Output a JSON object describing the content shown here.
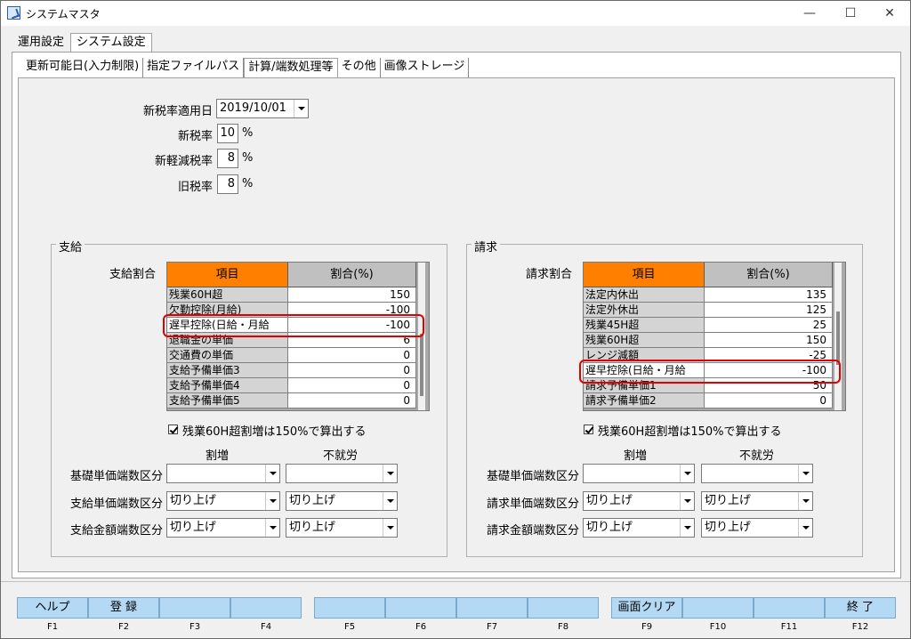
{
  "window": {
    "title": "システムマスタ",
    "minimize": "—",
    "maximize": "☐",
    "close": "✕"
  },
  "outer_tabs": [
    {
      "label": "運用設定"
    },
    {
      "label": "システム設定"
    }
  ],
  "inner_tabs": [
    {
      "label": "更新可能日(入力制限)"
    },
    {
      "label": "指定ファイルパス"
    },
    {
      "label": "計算/端数処理等"
    },
    {
      "label": "その他"
    },
    {
      "label": "画像ストレージ"
    }
  ],
  "tax": {
    "new_rate_date_label": "新税率適用日",
    "new_rate_date_value": "2019/10/01",
    "new_rate_label": "新税率",
    "new_rate_value": "10",
    "new_reduced_label": "新軽減税率",
    "new_reduced_value": "8",
    "old_rate_label": "旧税率",
    "old_rate_value": "8",
    "percent": "%"
  },
  "shikyu": {
    "group_title": "支給",
    "ratio_label": "支給割合",
    "headers": {
      "item": "項目",
      "rate": "割合(%)"
    },
    "rows": [
      {
        "name": "残業60H超",
        "value": "150"
      },
      {
        "name": "欠勤控除(月給)",
        "value": "-100"
      },
      {
        "name": "遅早控除(日給・月給",
        "value": "-100"
      },
      {
        "name": "退職金の単価",
        "value": "6"
      },
      {
        "name": "交通費の単価",
        "value": "0"
      },
      {
        "name": "支給予備単価3",
        "value": "0"
      },
      {
        "name": "支給予備単価4",
        "value": "0"
      },
      {
        "name": "支給予備単価5",
        "value": "0"
      }
    ],
    "checkbox_label": "残業60H超割増は150%で算出する",
    "col_warimashi": "割増",
    "col_fushuro": "不就労",
    "rounding": [
      {
        "label": "基礎単価端数区分",
        "warimashi": "",
        "fushuro": ""
      },
      {
        "label": "支給単価端数区分",
        "warimashi": "切り上げ",
        "fushuro": "切り上げ"
      },
      {
        "label": "支給金額端数区分",
        "warimashi": "切り上げ",
        "fushuro": "切り上げ"
      }
    ]
  },
  "seikyu": {
    "group_title": "請求",
    "ratio_label": "請求割合",
    "headers": {
      "item": "項目",
      "rate": "割合(%)"
    },
    "rows": [
      {
        "name": "法定内休出",
        "value": "135"
      },
      {
        "name": "法定外休出",
        "value": "125"
      },
      {
        "name": "残業45H超",
        "value": "25"
      },
      {
        "name": "残業60H超",
        "value": "150"
      },
      {
        "name": "レンジ減額",
        "value": "-25"
      },
      {
        "name": "遅早控除(日給・月給",
        "value": "-100"
      },
      {
        "name": "請求予備単価1",
        "value": "50"
      },
      {
        "name": "請求予備単価2",
        "value": "0"
      }
    ],
    "checkbox_label": "残業60H超割増は150%で算出する",
    "col_warimashi": "割増",
    "col_fushuro": "不就労",
    "rounding": [
      {
        "label": "基礎単価端数区分",
        "warimashi": "",
        "fushuro": ""
      },
      {
        "label": "請求単価端数区分",
        "warimashi": "切り上げ",
        "fushuro": "切り上げ"
      },
      {
        "label": "請求金額端数区分",
        "warimashi": "切り上げ",
        "fushuro": "切り上げ"
      }
    ]
  },
  "fkeys": [
    {
      "label": "ヘルプ",
      "key": "F1"
    },
    {
      "label": "登 録",
      "key": "F2"
    },
    {
      "label": "",
      "key": "F3"
    },
    {
      "label": "",
      "key": "F4"
    },
    {
      "label": "",
      "key": "F5"
    },
    {
      "label": "",
      "key": "F6"
    },
    {
      "label": "",
      "key": "F7"
    },
    {
      "label": "",
      "key": "F8"
    },
    {
      "label": "画面クリア",
      "key": "F9"
    },
    {
      "label": "",
      "key": "F10"
    },
    {
      "label": "",
      "key": "F11"
    },
    {
      "label": "終 了",
      "key": "F12"
    }
  ],
  "colors": {
    "header_orange": "#ff8000",
    "highlight_red": "#e00000",
    "fkey_blue": "#b4d9f5"
  }
}
